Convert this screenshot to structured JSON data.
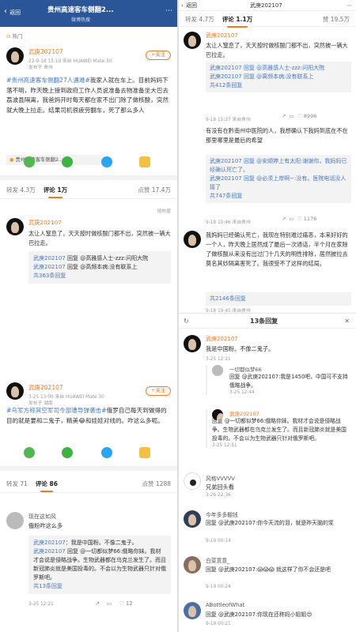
{
  "left": {
    "header": {
      "title": "贵州高速客车侧翻2...",
      "subtitle": "微博热搜",
      "back_label": "返回"
    },
    "topic_tag": "热门",
    "post1": {
      "author": "武庚202107",
      "meta1": "22-9-18 15:10 来自 HUAWEI Mate 30",
      "meta2": "发布于 贵州",
      "follow_label": "+关注",
      "hashtag": "#贵州高速客车侧翻27人遇难#",
      "text": "我家人就在车上。目前妈妈下落不明，昨天晚上接到政府工作人员说准备去物准备坐大巴去荔波县隔离，我爸妈开时每天都在家不出门除了做核酸，突然就大晚上拉走。结果司机很疲劳翻车，死了那么多人",
      "link_card": "贵州高速客车侧翻2..."
    },
    "stats1": {
      "repost": "转发 4.3万",
      "comment": "评论 1万",
      "like": "点赞 17.4万"
    },
    "comment1": {
      "author": "武庚202107",
      "text": "太让人窒息了，天天按时做核酸门都不出，突然被一辆大巴拉走。",
      "reply1_user": "武庚202107",
      "reply1_text": "回复 @高雅感人士-zzz:问阳大院",
      "reply2_user": "武庚202107",
      "reply2_text": "回复 @高频本病:没有联系上",
      "more": "共363条回复",
      "sort": "按热度"
    },
    "post2": {
      "author": "武庚202107",
      "meta1": "3-25 13:00 来自 HUAWEI Mate 30",
      "meta2": "发布于 湖南",
      "follow_label": "+关注",
      "hashtag": "#乌军方称其空军司令部遭导弹袭击#",
      "text": "俄罗自己每天到做得的目的就是要和二鬼子，精美😂和娃娃对线的。咋这么多呢。"
    },
    "stats2": {
      "repost": "转发 71",
      "comment": "评论 86",
      "like": "点赞 1288"
    },
    "comment2": {
      "author": "现在这如风",
      "text": "俄粉咋这么多",
      "reply1_user": "武庚202107",
      "reply1_text": "：我是中国粉。不像二鬼子。",
      "reply2_user": "武庚202107",
      "reply2_text": "回复 @一切都似梦66:俄略你妹。我材才会说是侵略战争。生物武器都在乌克兰发生了。而且新冠肺炎就是美国投毒的。不会以为生物武器只针对俄罗斯吧。",
      "more": "共13条回复",
      "time": "3-25 12:21",
      "like": "12"
    }
  },
  "right": {
    "header": {
      "back_label": "返回",
      "title": "武庚202107"
    },
    "stats": {
      "repost": "转发 4.7万",
      "comment": "评论 1.1万",
      "like": "赞 19.5万"
    },
    "comment1": {
      "author": "武庚202107",
      "text": "太让人窒息了，天天按时做核酸门都不出，突然被一辆大巴拉走。",
      "r1": "武庚202107 回复 @高雅感人士-zzz:问阳大院",
      "r2": "武庚202107 回复 @离频本病:没有联系上",
      "more": "共412条回复",
      "time": "9-18 15:37 来自贵州",
      "like": "8996"
    },
    "comment2": {
      "text": "有没有在黔南州中医院的人，我想确认下我妈到底在不在那里哪里是最后的希望",
      "r1": "武庚202107 回复 @安顺婷上有太阳:谢谢你。我妈妈已经确认死亡了。",
      "r2": "武庚202107 回复 @必须上岸啊~:没有。医院电话没人接了",
      "more": "共747条回复",
      "time": "9-18 15:46 来自贵州",
      "like": "1176"
    },
    "comment3": {
      "text": "我妈妈已经确认死亡，我现在特别难过痛恶，本来好好的一个人，昨天晚上居然成了最后一次通话，半个月在家除了做核酸从来没有出过门十几天的明性排除，居然被拉去莫名其妙隔离害死了。我很受不了这样的结局。",
      "more": "共2146条回复",
      "time": "9-18 19:45 来自贵州"
    },
    "replies_panel": {
      "title": "13条回复",
      "c1_author": "武庚202107",
      "c1_text": "我是中国粉。不像二鬼子。",
      "c1_time": "3-25 12:21",
      "c1_sub_author": "一切都似梦66",
      "c1_sub_text": "回复 @武庚202107:我是1450吧，中国可不支持俄略战争。",
      "c1_sub_time": "3-25 12:44",
      "c2_author": "武庚202107",
      "c2_text": "回复 @一切都似梦66:俄略你妹。我材才会说是侵略战争。生物武器都在乌克兰发生了。而且新冠肺炎就是美国投毒的。不会以为生物武器只针对俄罗斯吧。",
      "c2_time": "3-25 12:51",
      "c3_author": "风格VVVVV",
      "c3_text": "兄弟回头看",
      "c3_time": "3-26 22:36",
      "c4_author": "今年多多棚钱",
      "c4_text": "回复 @武庚202107:你今天流的泪，就是昨天脑的浆",
      "c4_time": "9-19 00:14",
      "c5_author": "白菜意意_",
      "c5_text": "回复 @武庚202107:😱😱😱 就这样了你不会还是吧",
      "c5_time": "9-19 00:24",
      "c6_author": "ABottleofWhat",
      "c6_text": "回复 @武庚202107:你现在还称妈小姐姐😍",
      "c6_time": "9-19 00:21"
    }
  }
}
